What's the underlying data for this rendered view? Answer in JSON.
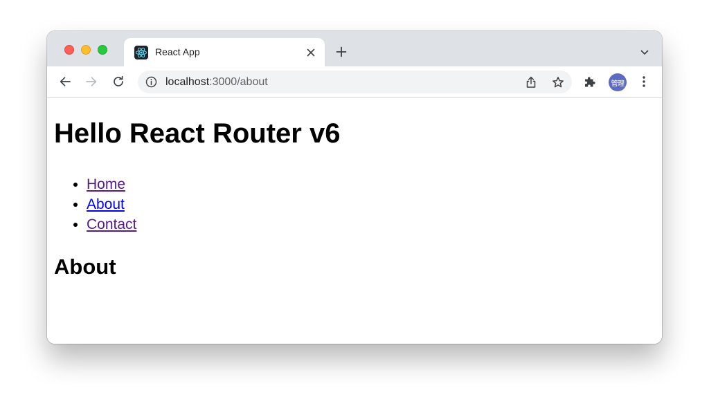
{
  "browser": {
    "tab": {
      "title": "React App",
      "favicon": "react-logo-icon"
    },
    "address_bar": {
      "host": "localhost",
      "path": ":3000/about"
    },
    "profile_avatar_label": "管理",
    "icons": {
      "back": "arrow-left-icon",
      "forward": "arrow-right-icon",
      "reload": "reload-icon",
      "info": "info-icon",
      "share": "share-icon",
      "bookmark": "star-icon",
      "extensions": "puzzle-icon",
      "menu": "kebab-menu-icon",
      "close_tab": "close-icon",
      "new_tab": "plus-icon",
      "tab_search": "chevron-down-icon"
    },
    "colors": {
      "tabstrip": "#dee1e6",
      "omnibox": "#f1f3f4",
      "avatar": "#5c6bc0",
      "traffic_red": "#ff5f57",
      "traffic_yellow": "#febc2e",
      "traffic_green": "#28c840"
    }
  },
  "page": {
    "heading": "Hello React Router v6",
    "nav": [
      {
        "label": "Home",
        "state": "visited",
        "color": "#551a8b"
      },
      {
        "label": "About",
        "state": "unvisited",
        "color": "#0000ee"
      },
      {
        "label": "Contact",
        "state": "visited",
        "color": "#551a8b"
      }
    ],
    "subheading": "About"
  }
}
